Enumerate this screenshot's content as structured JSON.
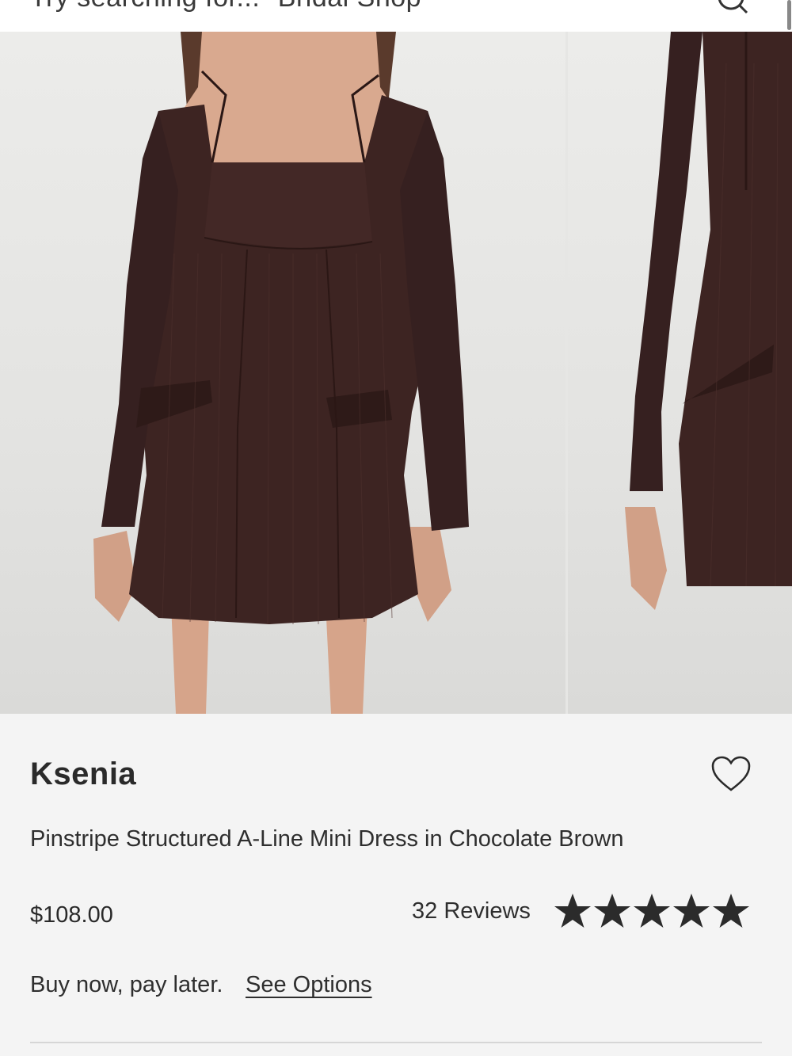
{
  "search": {
    "placeholder_text": "Try searching for... \"Bridal Shop\""
  },
  "carousel": {
    "images": [
      {
        "alt": "Model wearing chocolate brown pinstripe mini dress, front view"
      },
      {
        "alt": "Model wearing chocolate brown pinstripe mini dress, side view"
      }
    ],
    "dress_color": "#3b2220"
  },
  "product": {
    "brand": "Ksenia",
    "name": "Pinstripe Structured A-Line Mini Dress in Chocolate Brown",
    "price": "$108.00",
    "reviews_label": "32 Reviews",
    "rating": 5,
    "rating_max": 5,
    "bnpl_text": "Buy now, pay later.",
    "bnpl_link": "See Options"
  },
  "icons": {
    "search": "search-icon",
    "wishlist": "heart-outline-icon",
    "rating": "star-filled-icon"
  },
  "colors": {
    "text": "#2a2a2a",
    "star": "#2b2b2b",
    "background": "#f4f4f4"
  }
}
